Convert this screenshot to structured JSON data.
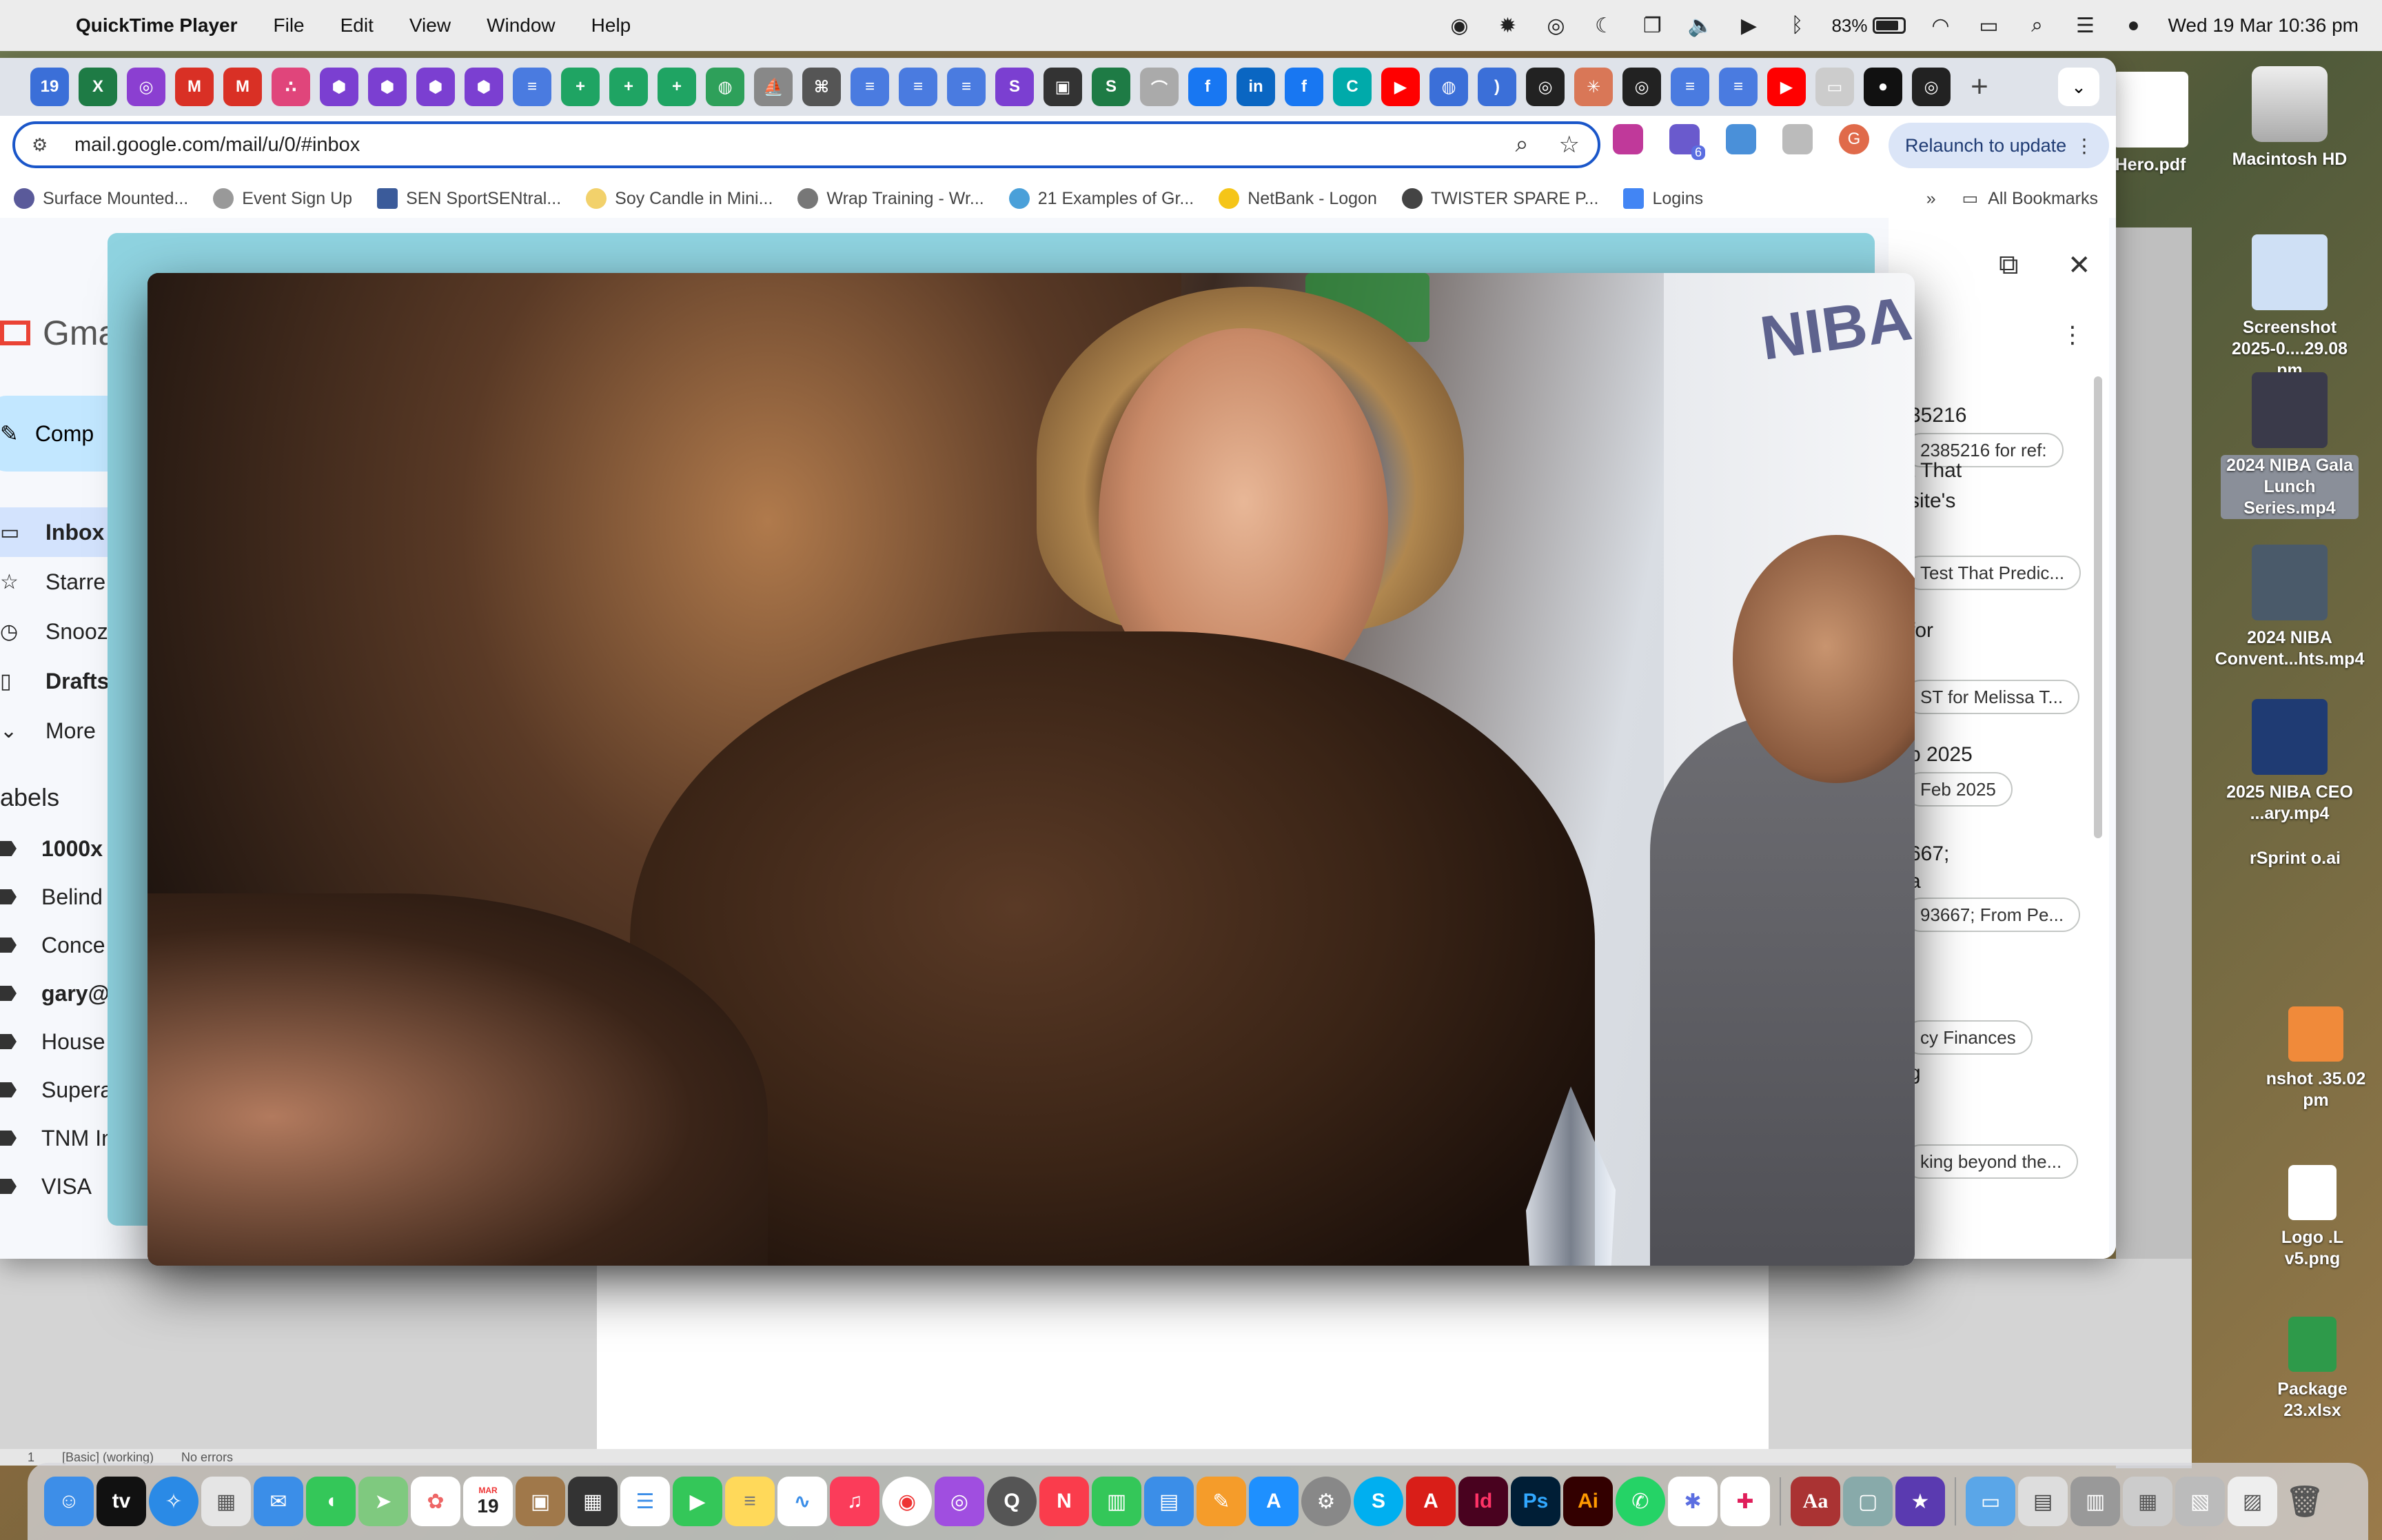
{
  "menubar": {
    "app": "QuickTime Player",
    "menus": [
      "File",
      "Edit",
      "View",
      "Window",
      "Help"
    ],
    "battery_pct": "83%",
    "battery_level": 0.83,
    "clock": "Wed 19 Mar  10:36 pm"
  },
  "browser": {
    "url": "mail.google.com/mail/u/0/#inbox",
    "relaunch_label": "Relaunch to update",
    "profile_initial": "G",
    "extension_badge": "6",
    "bookmarks": [
      "Surface Mounted...",
      "Event Sign Up",
      "SEN SportSENtral...",
      "Soy Candle in Mini...",
      "Wrap Training - Wr...",
      "21 Examples of Gr...",
      "NetBank - Logon",
      "TWISTER SPARE P...",
      "Logins"
    ],
    "all_bookmarks": "All Bookmarks"
  },
  "gmail": {
    "logo_text": "Gma",
    "compose": "Comp",
    "nav": [
      "Inbox",
      "Starre",
      "Snooz",
      "Drafts",
      "More"
    ],
    "labels_heading": "abels",
    "labels": [
      "1000x",
      "Belind",
      "Conce",
      "gary@",
      "House",
      "Supera",
      "TNM In",
      "VISA"
    ],
    "right_texts": [
      "35216",
      "t That",
      "site's",
      "for",
      "b 2025",
      "667;",
      "a",
      "g"
    ],
    "chips": [
      "2385216 for ref:",
      "Test That Predic...",
      "ST for Melissa T...",
      "Feb 2025",
      "93667; From Pe...",
      "cy Finances",
      "king beyond the..."
    ]
  },
  "video": {
    "banner_text": "NIBA"
  },
  "doc_status": {
    "page": "1",
    "mode": "[Basic] (working)",
    "errors": "No errors"
  },
  "desktop": {
    "items": [
      {
        "label": "Hero.pdf"
      },
      {
        "label": "Macintosh HD"
      },
      {
        "label": "Screenshot 2025-0....29.08 pm"
      },
      {
        "label": "2024 NIBA Gala Lunch Series.mp4"
      },
      {
        "label": "2024 NIBA Convent...hts.mp4"
      },
      {
        "label": "2025 NIBA CEO ...ary.mp4"
      },
      {
        "label": "rSprint o.ai"
      },
      {
        "label": "nshot .35.02 pm"
      },
      {
        "label": "Logo .L v5.png"
      },
      {
        "label": "Package 23.xlsx"
      }
    ]
  },
  "dock": {
    "apps": [
      "Finder",
      "Apple TV",
      "Safari",
      "Launchpad",
      "Mail",
      "Messages",
      "Maps",
      "Photos",
      "Calendar",
      "Contacts",
      "Calculator",
      "Reminders",
      "FaceTime",
      "Notes",
      "Freeform",
      "Music",
      "Chrome",
      "Podcasts",
      "QuickTime",
      "News",
      "Numbers",
      "Keynote",
      "Pages",
      "App Store",
      "System Settings",
      "Skype",
      "Acrobat",
      "InDesign",
      "Photoshop",
      "Illustrator",
      "WhatsApp",
      "Perplexity",
      "Slack",
      "Dictionary",
      "Preview",
      "iMovie",
      "Folder",
      "Downloads",
      "Trash"
    ],
    "calendar_day": "19",
    "calendar_month": "MAR"
  },
  "colors": {
    "omnibox_border": "#1a56c9",
    "relaunch_bg": "#dbe5f7",
    "gmail_active": "#d3e3fd",
    "compose_bg": "#c2e7ff"
  }
}
